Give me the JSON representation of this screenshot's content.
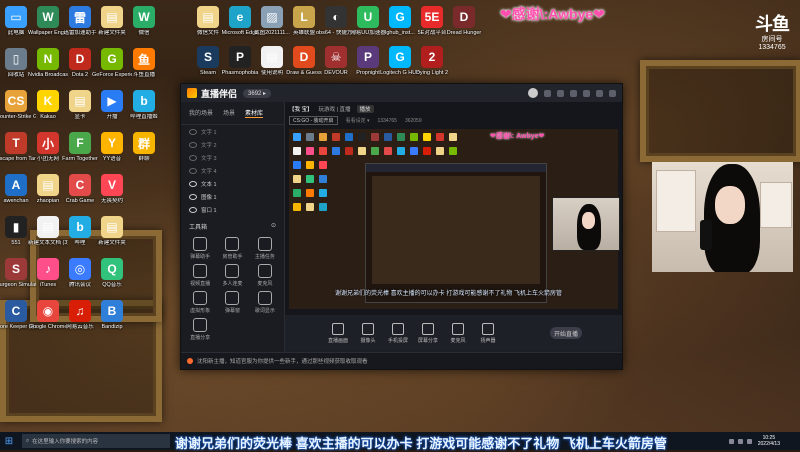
{
  "overlay": {
    "thanks_text": "❤感谢\\:Awbye❤",
    "platform_logo": "斗鱼",
    "platform_sub": "房间号",
    "room_id": "1334765",
    "side_thanks": "❤感谢\\: Awbye❤",
    "marquee": "谢谢兄弟们的荧光棒  喜欢主播的可以办卡  打游戏可能感谢不了礼物   飞机上车火箭房管"
  },
  "desktop_icons": [
    {
      "label": "此电脑",
      "color": "#3aa0ff",
      "glyph": "▭"
    },
    {
      "label": "回收站",
      "color": "#6b7d8c",
      "glyph": "▯"
    },
    {
      "label": "Counter-Strike Global Off..",
      "color": "#e8a23a",
      "glyph": "CS"
    },
    {
      "label": "Escape from Tarkov",
      "color": "#c03a2a",
      "glyph": "T"
    },
    {
      "label": "awenchan",
      "color": "#1f6fc9",
      "glyph": "A"
    },
    {
      "label": "551",
      "color": "#222222",
      "glyph": "▮"
    },
    {
      "label": "Surgeon Simulator",
      "color": "#9c3a3a",
      "glyph": "S"
    },
    {
      "label": "Core Keeper 测试",
      "color": "#2a5aa0",
      "glyph": "C"
    },
    {
      "label": "Wallpaper Engine",
      "color": "#2e8b57",
      "glyph": "W"
    },
    {
      "label": "Nvidia Broadcast",
      "color": "#76b900",
      "glyph": "N"
    },
    {
      "label": "Kakao",
      "color": "#ffd400",
      "glyph": "K"
    },
    {
      "label": "小团无网",
      "color": "#d2362c",
      "glyph": "小"
    },
    {
      "label": "zhaopian",
      "color": "#f0d48a",
      "glyph": "▤"
    },
    {
      "label": "新建文本文档 (3)",
      "color": "#f2f2f2",
      "glyph": "▤"
    },
    {
      "label": "iTunes",
      "color": "#ff4f8b",
      "glyph": "♪"
    },
    {
      "label": "Google Chrome",
      "color": "#e8453c",
      "glyph": "◉"
    },
    {
      "label": "迅雷加速助手",
      "color": "#2d7be0",
      "glyph": "雷"
    },
    {
      "label": "Dota 2",
      "color": "#c02a1c",
      "glyph": "D"
    },
    {
      "label": "显卡",
      "color": "#f0d48a",
      "glyph": "▤"
    },
    {
      "label": "Farm Together",
      "color": "#4aa84a",
      "glyph": "F"
    },
    {
      "label": "Crab Game",
      "color": "#e34b4b",
      "glyph": "C"
    },
    {
      "label": "哔哩",
      "color": "#23ade5",
      "glyph": "b"
    },
    {
      "label": "腾讯会议",
      "color": "#3a7bff",
      "glyph": "◎"
    },
    {
      "label": "网易云音乐",
      "color": "#d81e06",
      "glyph": "♫"
    },
    {
      "label": "新建文件夹",
      "color": "#f0d48a",
      "glyph": "▤"
    },
    {
      "label": "GeForce Experience",
      "color": "#76b900",
      "glyph": "G"
    },
    {
      "label": "开播",
      "color": "#2a7cf5",
      "glyph": "▶"
    },
    {
      "label": "YY语音",
      "color": "#ffb400",
      "glyph": "Y"
    },
    {
      "label": "无畏契约",
      "color": "#ff4655",
      "glyph": "V"
    },
    {
      "label": "新建文件夹",
      "color": "#f0d48a",
      "glyph": "▤"
    },
    {
      "label": "QQ音乐",
      "color": "#31c27c",
      "glyph": "Q"
    },
    {
      "label": "Bandizip",
      "color": "#2f7fd8",
      "glyph": "B"
    },
    {
      "label": "微信",
      "color": "#2aae67",
      "glyph": "W"
    },
    {
      "label": "斗鱼直播",
      "color": "#ff7a00",
      "glyph": "鱼"
    },
    {
      "label": "哔哩直播姬",
      "color": "#23ade5",
      "glyph": "b"
    },
    {
      "label": "群聊",
      "color": "#f7b500",
      "glyph": "群"
    }
  ],
  "desktop_icons_row2": [
    {
      "label": "微信文件",
      "color": "#f0d48a",
      "glyph": "▤"
    },
    {
      "label": "Microsoft Edge",
      "color": "#1ea3c9",
      "glyph": "e"
    },
    {
      "label": "截图2021111...",
      "color": "#8aa0b5",
      "glyph": "▨"
    },
    {
      "label": "英雄联盟",
      "color": "#c8a44a",
      "glyph": "L"
    },
    {
      "label": "obs64 - 快捷方式",
      "color": "#333333",
      "glyph": "◐"
    },
    {
      "label": "网易UU加速器",
      "color": "#2dbb5d",
      "glyph": "U"
    },
    {
      "label": "lghub_inst...",
      "color": "#00b8fc",
      "glyph": "G"
    },
    {
      "label": "5E对战平台",
      "color": "#e82a2a",
      "glyph": "5E"
    },
    {
      "label": "Dread Hunger",
      "color": "#7a2a2a",
      "glyph": "D"
    },
    {
      "label": "Steam",
      "color": "#1b3b5e",
      "glyph": "S"
    },
    {
      "label": "Phasmophobia",
      "color": "#222222",
      "glyph": "P"
    },
    {
      "label": "使用说明",
      "color": "#f2f2f2",
      "glyph": "▤"
    },
    {
      "label": "Draw & Guess",
      "color": "#e04a1c",
      "glyph": "D"
    },
    {
      "label": "DEVOUR",
      "color": "#a03030",
      "glyph": "☠"
    },
    {
      "label": "Propnight",
      "color": "#5a3a7a",
      "glyph": "P"
    },
    {
      "label": "Logitech G HUB",
      "color": "#00b8fc",
      "glyph": "G"
    },
    {
      "label": "Dying Light 2",
      "color": "#b11e1e",
      "glyph": "2"
    }
  ],
  "app": {
    "name": "直播伴侣",
    "user": "3692 ▸",
    "tabs": [
      "我的场景",
      "场景",
      "素材库"
    ],
    "sources": [
      "文字 1",
      "文字 2",
      "文字 3",
      "文字 4",
      "文本 1",
      "图像 1",
      "窗口 1"
    ],
    "tools_title": "工具箱",
    "tools": [
      "弹幕助手",
      "房管助手",
      "主播任务",
      "视频直播",
      "多人连麦",
      "麦克风",
      "虚拟形象",
      "弹幕窗",
      "歌词显示",
      "直播分享"
    ],
    "info_tag": "【我 宝】",
    "info_title": "玩游戏 | 直播",
    "info_extra": "播放",
    "sub_category": "CS:GO - 装动开启",
    "sub_setting": "看看设定 ▾",
    "sub_viewers": "1334765",
    "sub_heat": "362059",
    "preview_caption": "谢谢兄弟们的荧光棒  喜欢主播的可以办卡  打游戏可能感谢不了礼物    飞机上车火箭房管",
    "controls": [
      "直播画面",
      "摄像头",
      "手机投屏",
      "屏幕分享",
      "麦克风",
      "扬声器"
    ],
    "start_label": "开始直播",
    "notice": "沈阳新主播，知道官服为你提供一些新手，通过那些视频获取收取观看"
  },
  "taskbar": {
    "search_placeholder": "在这里输入你要搜索的内容",
    "time": "10:25",
    "date": "2022/4/13"
  }
}
